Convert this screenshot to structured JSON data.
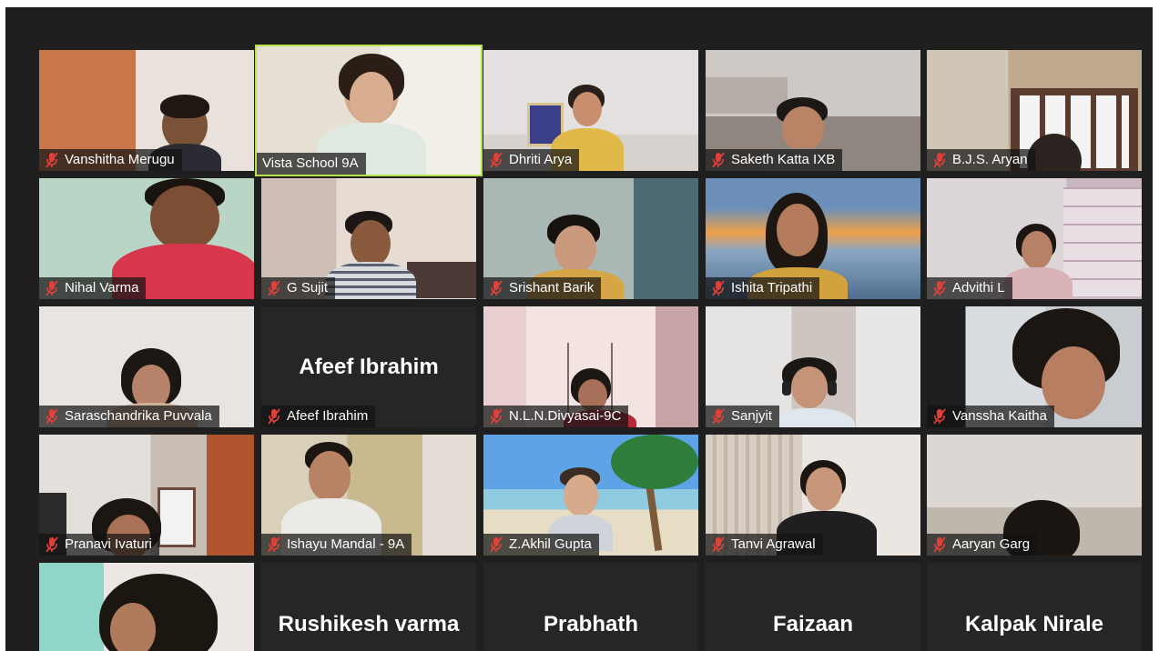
{
  "meeting": {
    "participants": [
      {
        "name": "Vanshitha Merugu",
        "muted": true
      },
      {
        "name": "Vista School 9A",
        "muted": false,
        "speaking": true
      },
      {
        "name": "Dhriti Arya",
        "muted": true
      },
      {
        "name": "Saketh Katta IXB",
        "muted": true
      },
      {
        "name": "B.J.S. Aryan",
        "muted": true
      },
      {
        "name": "Nihal Varma",
        "muted": true
      },
      {
        "name": "G Sujit",
        "muted": true
      },
      {
        "name": "Srishant Barik",
        "muted": true
      },
      {
        "name": "Ishita Tripathi",
        "muted": true
      },
      {
        "name": "Advithi L",
        "muted": true
      },
      {
        "name": "Saraschandrika Puvvala",
        "muted": true
      },
      {
        "name": "Afeef Ibrahim",
        "muted": true,
        "video_off": true,
        "big_label": "Afeef Ibrahim"
      },
      {
        "name": "N.L.N.Divyasai-9C",
        "muted": true
      },
      {
        "name": "Sanjyit",
        "muted": true
      },
      {
        "name": "Vanssha Kaitha",
        "muted": true
      },
      {
        "name": "Pranavi Ivaturi",
        "muted": true
      },
      {
        "name": "Ishayu Mandal - 9A",
        "muted": true
      },
      {
        "name": "Z.Akhil Gupta",
        "muted": true
      },
      {
        "name": "Tanvi Agrawal",
        "muted": true
      },
      {
        "name": "Aaryan Garg",
        "muted": true
      },
      {
        "name": "",
        "muted": true
      },
      {
        "name": "",
        "video_off": true,
        "big_label": "Rushikesh varma"
      },
      {
        "name": "",
        "video_off": true,
        "big_label": "Prabhath"
      },
      {
        "name": "",
        "video_off": true,
        "big_label": "Faizaan"
      },
      {
        "name": "",
        "video_off": true,
        "big_label": "Kalpak Nirale"
      }
    ]
  },
  "icons": {
    "mic": "muted-microphone-icon"
  },
  "colors": {
    "active_speaker_border": "#b7e34a",
    "muted_icon": "#e0403a",
    "grid_background": "#1f1f1f"
  }
}
